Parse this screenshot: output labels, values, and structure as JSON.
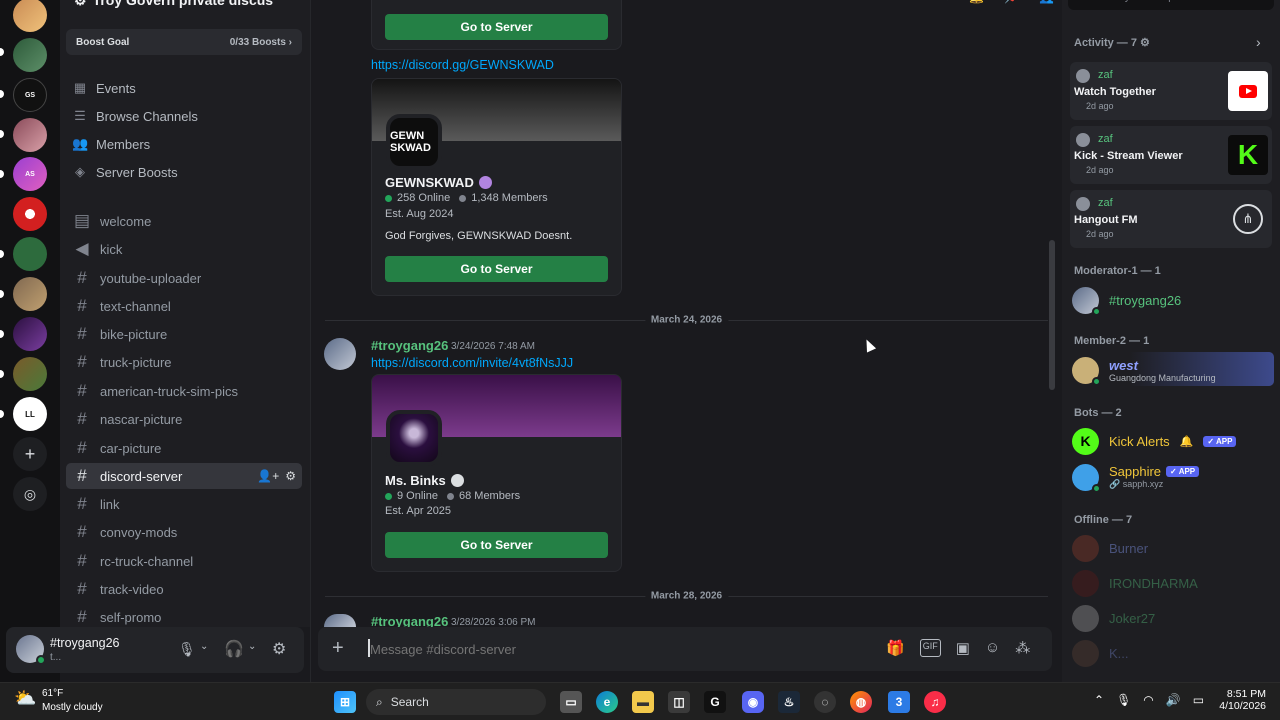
{
  "server": {
    "name": "Troy Govern private discus"
  },
  "boost": {
    "label": "Boost Goal",
    "count": "0/33 Boosts"
  },
  "nav": [
    {
      "label": "Events",
      "icon": "calendar-icon"
    },
    {
      "label": "Browse Channels",
      "icon": "list-icon"
    },
    {
      "label": "Members",
      "icon": "members-icon"
    },
    {
      "label": "Server Boosts",
      "icon": "boost-icon"
    }
  ],
  "channels": [
    "welcome",
    "kick",
    "youtube-uploader",
    "text-channel",
    "bike-picture",
    "truck-picture",
    "american-truck-sim-pics",
    "nascar-picture",
    "car-picture",
    "discord-server",
    "link",
    "convoy-mods",
    "rc-truck-channel",
    "track-video",
    "self-promo"
  ],
  "active_channel": "discord-server",
  "header": {
    "channel": "discord-server",
    "search_placeholder": "Search Troy Govern private discus"
  },
  "user": {
    "name": "#troygang26",
    "status": "t..."
  },
  "messages": {
    "top_button": "Go to Server",
    "link1": "https://discord.gg/GEWNSKWAD",
    "card1": {
      "icon_text": "GEWN SKWAD",
      "name": "GEWNSKWAD",
      "online": "258 Online",
      "members": "1,348 Members",
      "est": "Est. Aug 2024",
      "desc": "God Forgives, GEWNSKWAD Doesnt.",
      "button": "Go to Server"
    },
    "divider1": "March 24, 2026",
    "msg2_author": "#troygang26",
    "msg2_time": "3/24/2026 7:48 AM",
    "link2": "https://discord.com/invite/4vt8fNsJJJ",
    "card2": {
      "name": "Ms. Binks",
      "online": "9 Online",
      "members": "68 Members",
      "est": "Est. Apr 2025",
      "button": "Go to Server"
    },
    "divider2": "March 28, 2026",
    "msg3_author": "#troygang26",
    "msg3_time": "3/28/2026 3:06 PM"
  },
  "composer": {
    "placeholder": "Message #discord-server"
  },
  "members_panel": {
    "activity_header": "Activity — 7",
    "activities": [
      {
        "who": "zaf",
        "title": "Watch Together",
        "ago": "2d ago",
        "thumb": "youtube-icon"
      },
      {
        "who": "zaf",
        "title": "Kick - Stream Viewer",
        "ago": "2d ago",
        "thumb": "kick-icon"
      },
      {
        "who": "zaf",
        "title": "Hangout FM",
        "ago": "2d ago",
        "thumb": "hangout-icon"
      }
    ],
    "moderator_header": "Moderator-1 — 1",
    "moderator": "#troygang26",
    "member_header": "Member-2 — 1",
    "member": {
      "name": "west",
      "sub": "Guangdong Manufacturing"
    },
    "bots_header": "Bots — 2",
    "bots": [
      {
        "name": "Kick Alerts",
        "tag": "APP",
        "sub": ""
      },
      {
        "name": "Sapphire",
        "tag": "APP",
        "sub": "sapph.xyz"
      }
    ],
    "offline_header": "Offline — 7",
    "offline": [
      "Burner",
      "IRONDHARMA",
      "Joker27",
      "K..."
    ]
  },
  "taskbar": {
    "weather_temp": "61°F",
    "weather_desc": "Mostly cloudy",
    "search": "Search",
    "time": "8:51 PM",
    "date": "4/10/2026"
  },
  "colors": {
    "accent_green": "#248045",
    "link": "#00a8fc",
    "online": "#23a55a"
  }
}
